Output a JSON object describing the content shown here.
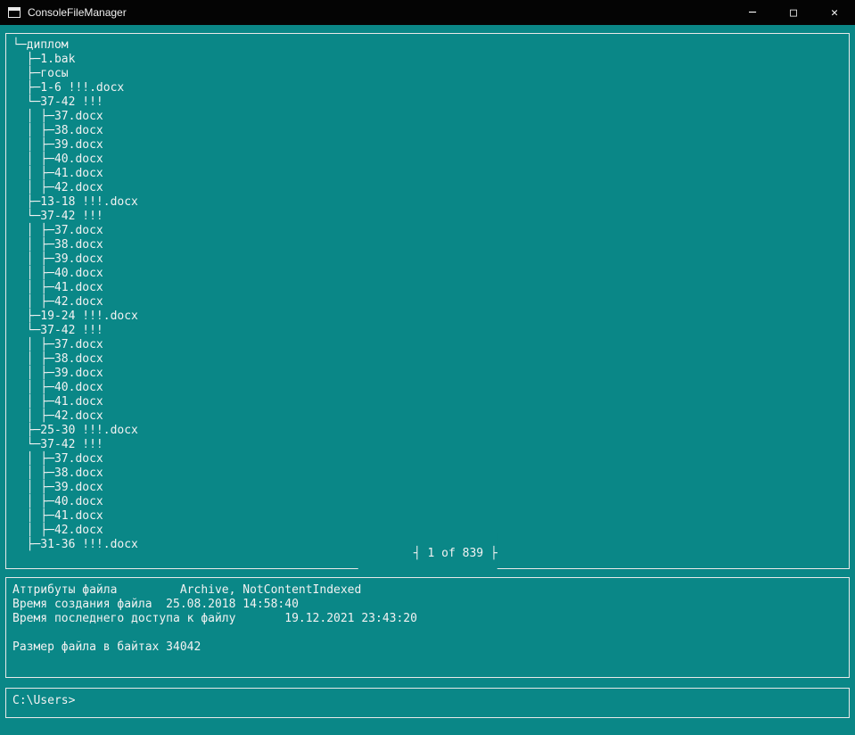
{
  "window": {
    "title": "ConsoleFileManager",
    "controls": {
      "minimize_icon": "─",
      "maximize_icon": "□",
      "close_icon": "✕"
    }
  },
  "colors": {
    "background": "#0A8787",
    "titlebar": "#040404",
    "text": "#F2F2F2",
    "panel_border": "#E9E9E9"
  },
  "tree_panel": {
    "lines": [
      "└─диплом",
      "  ├─1.bak",
      "  ├─госы",
      "  ├─1-6 !!!.docx",
      "  └─37-42 !!!",
      "  │ ├─37.docx",
      "  │ ├─38.docx",
      "  │ ├─39.docx",
      "  │ ├─40.docx",
      "  │ ├─41.docx",
      "  │ ├─42.docx",
      "  ├─13-18 !!!.docx",
      "  └─37-42 !!!",
      "  │ ├─37.docx",
      "  │ ├─38.docx",
      "  │ ├─39.docx",
      "  │ ├─40.docx",
      "  │ ├─41.docx",
      "  │ ├─42.docx",
      "  ├─19-24 !!!.docx",
      "  └─37-42 !!!",
      "  │ ├─37.docx",
      "  │ ├─38.docx",
      "  │ ├─39.docx",
      "  │ ├─40.docx",
      "  │ ├─41.docx",
      "  │ ├─42.docx",
      "  ├─25-30 !!!.docx",
      "  └─37-42 !!!",
      "  │ ├─37.docx",
      "  │ ├─38.docx",
      "  │ ├─39.docx",
      "  │ ├─40.docx",
      "  │ ├─41.docx",
      "  │ ├─42.docx",
      "  ├─31-36 !!!.docx"
    ],
    "pager": "┤ 1 of 839 ├"
  },
  "info_panel": {
    "lines": [
      "Аттрибуты файла         Archive, NotContentIndexed",
      "Время создания файла  25.08.2018 14:58:40",
      "Время последнего доступа к файлу       19.12.2021 23:43:20",
      "",
      "Размер файла в байтах 34042"
    ]
  },
  "command_panel": {
    "prompt": "C:\\Users>"
  }
}
